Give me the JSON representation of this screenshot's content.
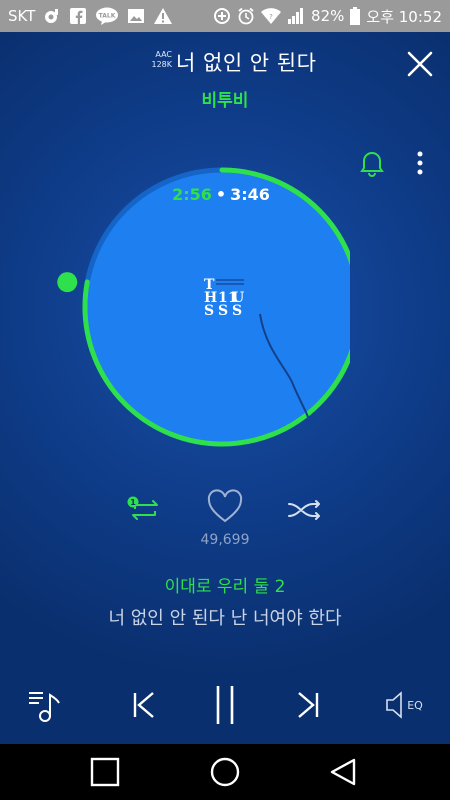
{
  "status": {
    "carrier": "SKT",
    "talk_label": "TALK",
    "battery": "82%",
    "time": "오후 10:52"
  },
  "header": {
    "codec_line1": "AAC",
    "codec_line2": "128K",
    "song_title": "너 없인 안 된다",
    "artist": "비투비"
  },
  "player": {
    "current_time": "2:56",
    "separator": "•",
    "total_time": "3:46",
    "progress": 0.779,
    "album_art_text": "THISS 11US SSS",
    "repeat_count": "1",
    "like_count": "49,699"
  },
  "lyrics": {
    "current": "이대로 우리 둘 2",
    "next": "너 없인 안 된다 난 너여야 한다"
  },
  "playbar": {
    "eq_label": "EQ"
  },
  "colors": {
    "accent": "#2ee04c",
    "disc": "#1e7ff0",
    "background": "#0a2f6e",
    "status_bar": "#9a9a9a"
  }
}
